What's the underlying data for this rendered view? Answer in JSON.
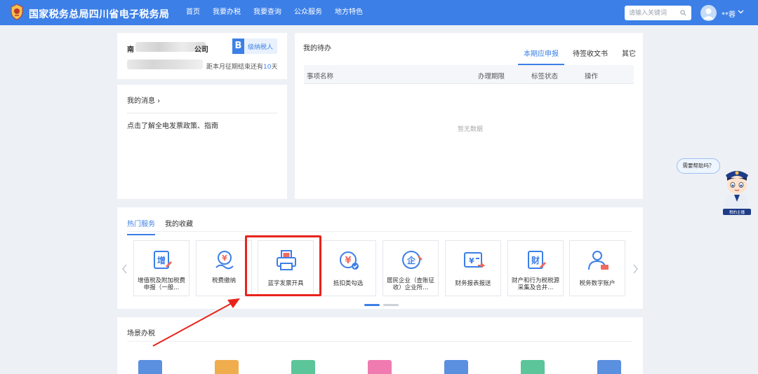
{
  "header": {
    "site_title": "国家税务总局四川省电子税务局",
    "nav": [
      "首页",
      "我要办税",
      "我要查询",
      "公众服务",
      "地方特色"
    ],
    "search_placeholder": "请输入关键词",
    "user_name": "**蓉",
    "brand_color": "#3c7fe7"
  },
  "company": {
    "name_start": "南",
    "name_end": "公司",
    "taxpayer_badge_letter": "B",
    "taxpayer_badge_text": "级纳税人",
    "deadline_prefix": "距本月征期结束还有",
    "deadline_days": "10",
    "deadline_suffix": "天"
  },
  "messages": {
    "title": "我的消息 ›",
    "item": "点击了解全电发票政策、指南"
  },
  "todo": {
    "title": "我的待办",
    "tabs": [
      "本期应申报",
      "待签收文书",
      "其它"
    ],
    "columns": [
      "事项名称",
      "办理期限",
      "标签状态",
      "操作"
    ],
    "empty_text": "暂无数据"
  },
  "hot_services": {
    "tabs": [
      "热门服务",
      "我的收藏"
    ],
    "tiles": [
      {
        "label": "增值税及附加税费申报（一般...",
        "icon": "vat-declaration-icon"
      },
      {
        "label": "税费缴纳",
        "icon": "tax-payment-icon"
      },
      {
        "label": "蓝字发票开具",
        "icon": "invoice-printer-icon"
      },
      {
        "label": "抵扣类勾选",
        "icon": "deduction-check-icon"
      },
      {
        "label": "居民企业（查账征收）企业所...",
        "icon": "enterprise-income-icon"
      },
      {
        "label": "财务报表报送",
        "icon": "financial-report-icon"
      },
      {
        "label": "财产和行为税税源采集及合并...",
        "icon": "property-tax-icon"
      },
      {
        "label": "税务数字账户",
        "icon": "digital-account-icon"
      }
    ],
    "carousel_pages": 2
  },
  "scenario": {
    "title": "场景办税",
    "icon_colors": [
      "#5b8fe0",
      "#f0ad4e",
      "#5cc59a",
      "#f07bb0",
      "#5b8fe0",
      "#5cc59a",
      "#5b8fe0"
    ]
  },
  "helper": {
    "bubble_text": "需要帮助吗？",
    "mascot_label": "税的主播"
  }
}
